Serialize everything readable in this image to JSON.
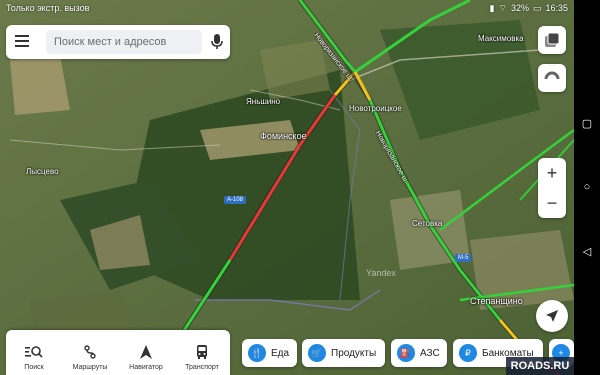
{
  "status": {
    "left_text": "Только экстр. вызов",
    "battery": "32%",
    "time": "16:35"
  },
  "search": {
    "placeholder": "Поиск мест и адресов"
  },
  "map": {
    "places": [
      {
        "name": "Максимовка"
      },
      {
        "name": "Яньшино"
      },
      {
        "name": "Новотроицкое"
      },
      {
        "name": "Фоминское"
      },
      {
        "name": "Лысцево"
      },
      {
        "name": "Сетовка"
      },
      {
        "name": "Степанщино"
      }
    ],
    "roads": [
      {
        "name": "Новорязанское ш."
      },
      {
        "name": "Новорязанское ш."
      },
      {
        "name": "А-108"
      },
      {
        "name": "М-5"
      }
    ],
    "logo": "Yandex"
  },
  "zoom": {
    "in": "+",
    "out": "−"
  },
  "bottom_nav": [
    {
      "label": "Поиск"
    },
    {
      "label": "Маршруты"
    },
    {
      "label": "Навигатор"
    },
    {
      "label": "Транспорт"
    }
  ],
  "categories": [
    {
      "label": "Еда"
    },
    {
      "label": "Продукты"
    },
    {
      "label": "АЗС"
    },
    {
      "label": "Банкоматы"
    }
  ],
  "watermark": "ROADS.RU",
  "colors": {
    "accent": "#1e88e5",
    "traffic_green": "#35d13a",
    "traffic_yellow": "#f2c21b",
    "traffic_red": "#e53935"
  }
}
